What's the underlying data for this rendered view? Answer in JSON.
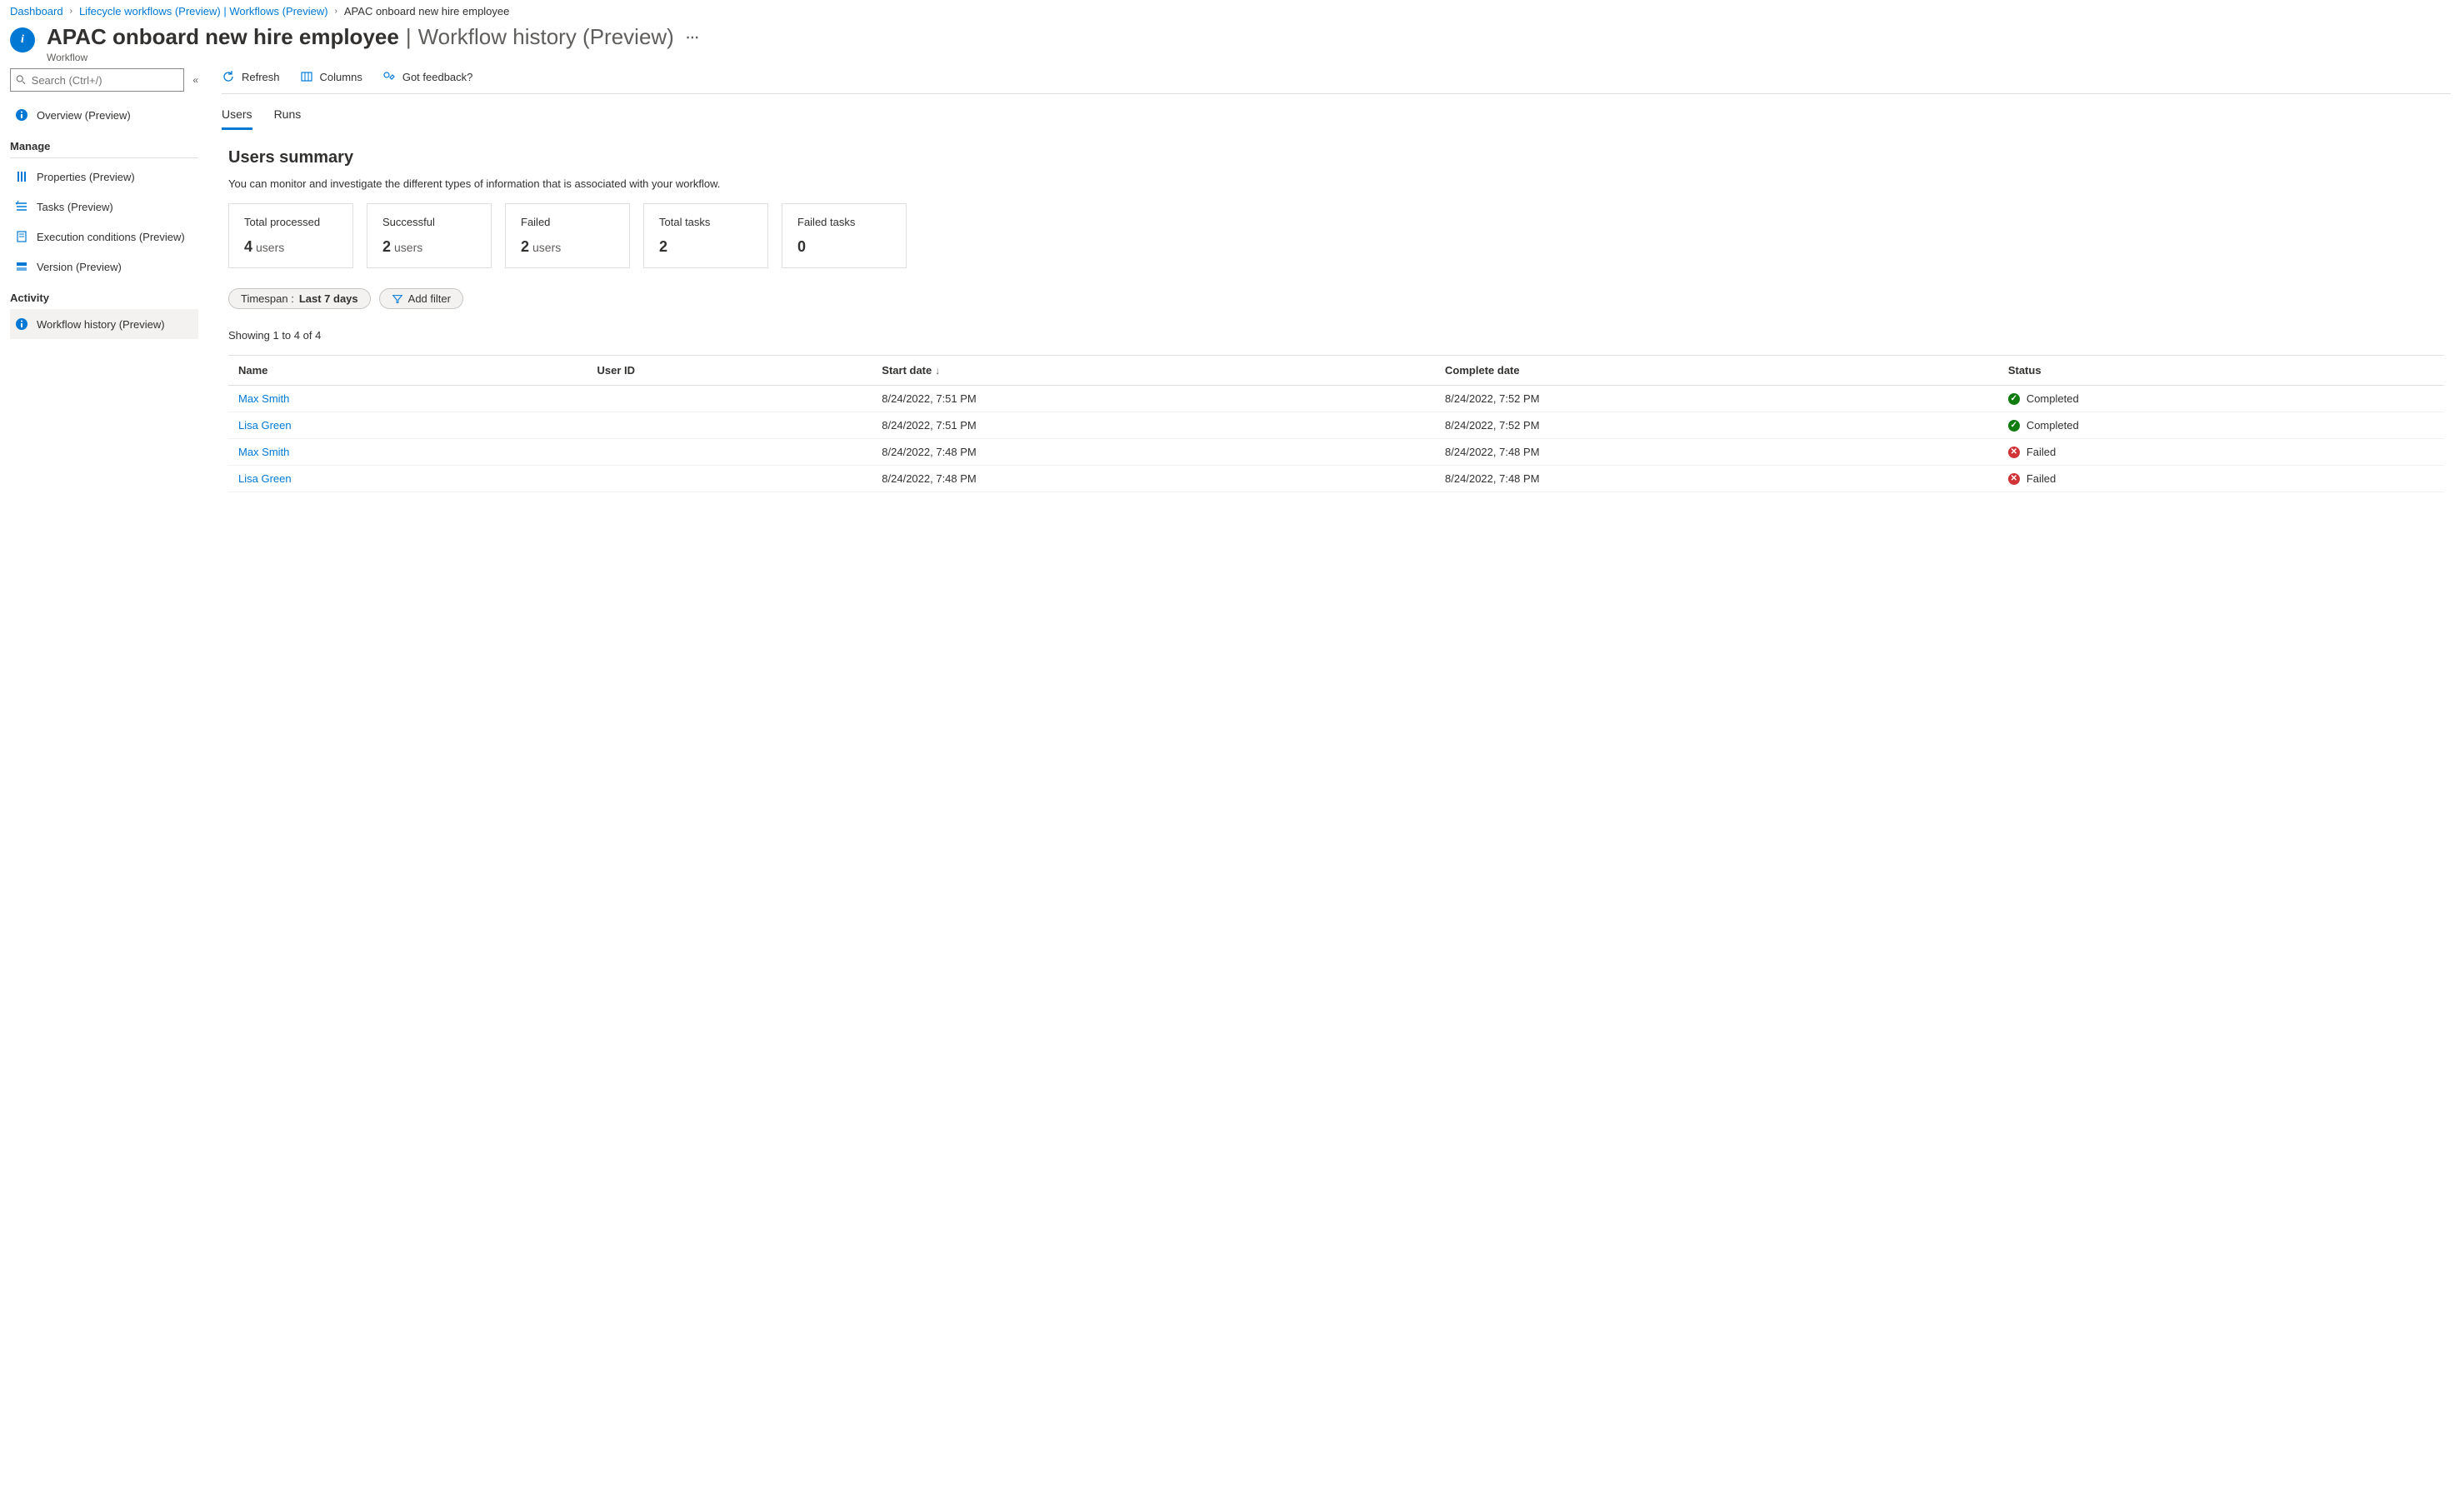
{
  "breadcrumb": [
    {
      "label": "Dashboard",
      "type": "link"
    },
    {
      "label": "Lifecycle workflows (Preview) | Workflows (Preview)",
      "type": "link"
    },
    {
      "label": "APAC onboard new hire employee",
      "type": "current"
    }
  ],
  "header": {
    "title_bold": "APAC onboard new hire employee",
    "title_light": "Workflow history (Preview)",
    "subtitle": "Workflow"
  },
  "sidebar": {
    "search_placeholder": "Search (Ctrl+/)",
    "top": [
      {
        "label": "Overview (Preview)",
        "icon": "info"
      }
    ],
    "groups": [
      {
        "label": "Manage",
        "items": [
          {
            "label": "Properties (Preview)",
            "icon": "sliders"
          },
          {
            "label": "Tasks (Preview)",
            "icon": "checklist"
          },
          {
            "label": "Execution conditions (Preview)",
            "icon": "doc"
          },
          {
            "label": "Version (Preview)",
            "icon": "stack"
          }
        ]
      },
      {
        "label": "Activity",
        "items": [
          {
            "label": "Workflow history (Preview)",
            "icon": "info",
            "active": true
          }
        ]
      }
    ]
  },
  "toolbar": {
    "refresh": "Refresh",
    "columns": "Columns",
    "feedback": "Got feedback?"
  },
  "tabs": [
    {
      "label": "Users",
      "active": true
    },
    {
      "label": "Runs",
      "active": false
    }
  ],
  "section": {
    "heading": "Users summary",
    "description": "You can monitor and investigate the different types of information that is associated with your workflow."
  },
  "cards": [
    {
      "label": "Total processed",
      "value": "4",
      "suffix": "users"
    },
    {
      "label": "Successful",
      "value": "2",
      "suffix": "users"
    },
    {
      "label": "Failed",
      "value": "2",
      "suffix": "users"
    },
    {
      "label": "Total tasks",
      "value": "2",
      "suffix": ""
    },
    {
      "label": "Failed tasks",
      "value": "0",
      "suffix": ""
    }
  ],
  "filters": {
    "timespan_prefix": "Timespan : ",
    "timespan_value": "Last 7 days",
    "add_filter": "Add filter"
  },
  "count_line": "Showing 1 to 4 of 4",
  "table": {
    "columns": [
      "Name",
      "User ID",
      "Start date",
      "Complete date",
      "Status"
    ],
    "sort_col": 2,
    "rows": [
      {
        "name": "Max Smith",
        "user_id": "",
        "start": "8/24/2022, 7:51 PM",
        "complete": "8/24/2022, 7:52 PM",
        "status": "Completed",
        "ok": true
      },
      {
        "name": "Lisa Green",
        "user_id": "",
        "start": "8/24/2022, 7:51 PM",
        "complete": "8/24/2022, 7:52 PM",
        "status": "Completed",
        "ok": true
      },
      {
        "name": "Max Smith",
        "user_id": "",
        "start": "8/24/2022, 7:48 PM",
        "complete": "8/24/2022, 7:48 PM",
        "status": "Failed",
        "ok": false
      },
      {
        "name": "Lisa Green",
        "user_id": "",
        "start": "8/24/2022, 7:48 PM",
        "complete": "8/24/2022, 7:48 PM",
        "status": "Failed",
        "ok": false
      }
    ]
  }
}
